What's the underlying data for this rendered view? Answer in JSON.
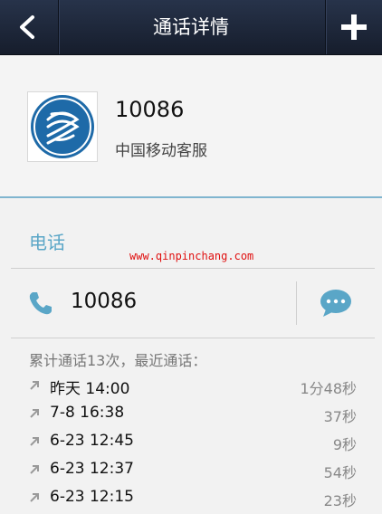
{
  "titlebar": {
    "title": "通话详情",
    "back_icon": "chevron-left-icon",
    "add_icon": "plus-icon"
  },
  "contact": {
    "number": "10086",
    "name": "中国移动客服",
    "avatar_icon": "china-mobile-logo-icon"
  },
  "section": {
    "title": "电话"
  },
  "watermark": "www.qinpinchang.com",
  "phone": {
    "number": "10086",
    "icon": "phone-icon",
    "message_icon": "chat-bubble-icon"
  },
  "history": {
    "summary": "累计通话13次，最近通话：",
    "calls": [
      {
        "time": "昨天 14:00",
        "duration": "1分48秒"
      },
      {
        "time": "7-8 16:38",
        "duration": "37秒"
      },
      {
        "time": "6-23 12:45",
        "duration": "9秒"
      },
      {
        "time": "6-23 12:37",
        "duration": "54秒"
      },
      {
        "time": "6-23 12:15",
        "duration": "23秒"
      }
    ]
  },
  "colors": {
    "titlebar": "#1c2435",
    "accent": "#5aa6c7",
    "logo": "#1e6aa8",
    "watermark": "#e01010"
  }
}
